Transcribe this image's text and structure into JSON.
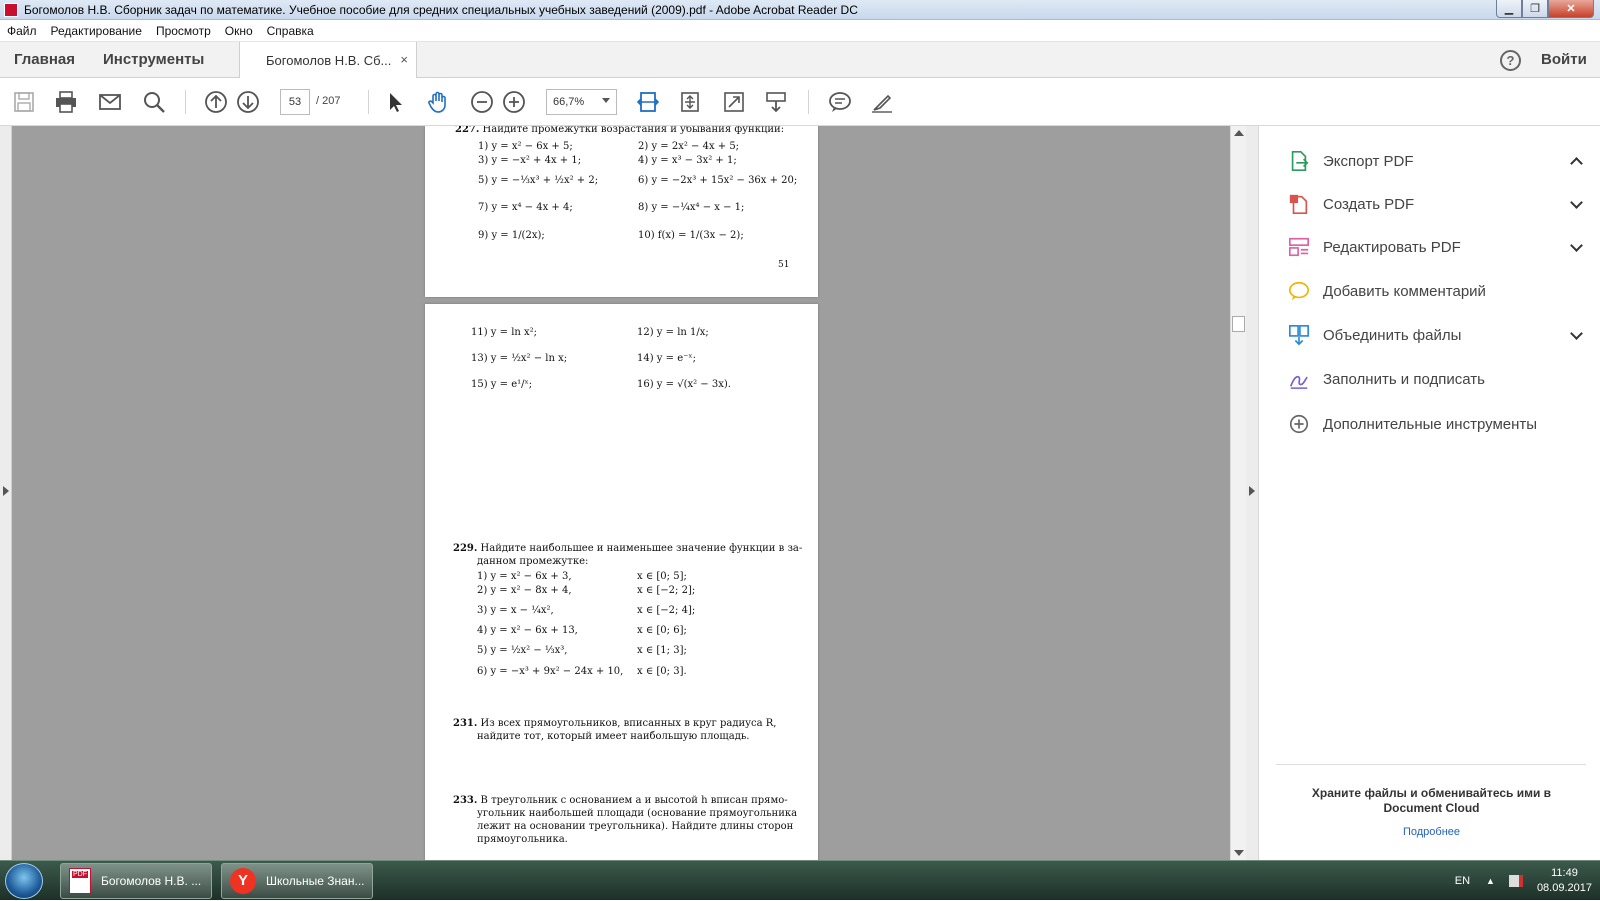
{
  "window": {
    "title": "Богомолов Н.В. Сборник задач по математике. Учебное пособие для средних специальных учебных заведений (2009).pdf - Adobe Acrobat Reader DC"
  },
  "menu": [
    "Файл",
    "Редактирование",
    "Просмотр",
    "Окно",
    "Справка"
  ],
  "tabs": {
    "home": "Главная",
    "tools": "Инструменты",
    "document": "Богомолов Н.В. Сб...",
    "close": "×",
    "help": "?",
    "signin": "Войти"
  },
  "toolbar": {
    "current_page": "53",
    "total_pages": "/ 207",
    "zoom": "66,7%"
  },
  "page1": {
    "lines": [
      {
        "num": "227.",
        "text": "Найдите промежутки возрастания и убывания функции:"
      },
      {
        "num": "",
        "text": "1) y = x² − 6x + 5;"
      },
      {
        "num": "",
        "text": "2) y = 2x² − 4x + 5;"
      },
      {
        "num": "",
        "text": "3) y = −x² + 4x + 1;"
      },
      {
        "num": "",
        "text": "4) y = x³ − 3x² + 1;"
      },
      {
        "num": "",
        "text": "5) y = −⅓x³ + ½x² + 2;"
      },
      {
        "num": "",
        "text": "6) y = −2x³ + 15x² − 36x + 20;"
      },
      {
        "num": "",
        "text": "7) y = x⁴ − 4x + 4;"
      },
      {
        "num": "",
        "text": "8) y = −¼x⁴ − x − 1;"
      },
      {
        "num": "",
        "text": "9) y = 1/(2x);"
      },
      {
        "num": "",
        "text": "10) f(x) = 1/(3x − 2);"
      }
    ],
    "page_number": "51"
  },
  "page2": {
    "lines": [
      {
        "num": "",
        "text": "11) y = ln x²;"
      },
      {
        "num": "",
        "text": "12) y = ln 1/x;"
      },
      {
        "num": "",
        "text": "13) y = ½x² − ln x;"
      },
      {
        "num": "",
        "text": "14) y = e⁻ˣ;"
      },
      {
        "num": "",
        "text": "15) y = e¹/ˣ;"
      },
      {
        "num": "",
        "text": "16) y = √(x² − 3x)."
      },
      {
        "num": "229.",
        "text": "Найдите наибольшее и наименьшее значение функции в за-"
      },
      {
        "num": "",
        "text": "данном промежутке:"
      },
      {
        "num": "",
        "text": "1) y = x² − 6x + 3,"
      },
      {
        "num": "",
        "text": "x ∈ [0; 5];"
      },
      {
        "num": "",
        "text": "2) y = x² − 8x + 4,"
      },
      {
        "num": "",
        "text": "x ∈ [−2; 2];"
      },
      {
        "num": "",
        "text": "3) y = x − ¼x²,"
      },
      {
        "num": "",
        "text": "x ∈ [−2; 4];"
      },
      {
        "num": "",
        "text": "4) y = x² − 6x + 13,"
      },
      {
        "num": "",
        "text": "x ∈ [0; 6];"
      },
      {
        "num": "",
        "text": "5) y = ½x² − ⅓x³,"
      },
      {
        "num": "",
        "text": "x ∈ [1; 3];"
      },
      {
        "num": "",
        "text": "6) y = −x³ + 9x² − 24x + 10,"
      },
      {
        "num": "",
        "text": "x ∈ [0; 3]."
      },
      {
        "num": "231.",
        "text": "Из всех прямоугольников, вписанных в круг радиуса R,"
      },
      {
        "num": "",
        "text": "найдите тот, который имеет наибольшую площадь."
      },
      {
        "num": "233.",
        "text": "В треугольник с основанием a и высотой h вписан прямо-"
      },
      {
        "num": "",
        "text": "угольник наибольшей площади (основание прямоугольника"
      },
      {
        "num": "",
        "text": "лежит на основании треугольника). Найдите длины сторон"
      },
      {
        "num": "",
        "text": "прямоугольника."
      }
    ]
  },
  "right_panel": {
    "items": [
      {
        "label": "Экспорт PDF",
        "icon": "export-pdf-icon",
        "color": "#2d9b5f"
      },
      {
        "label": "Создать PDF",
        "icon": "create-pdf-icon",
        "color": "#d9534f"
      },
      {
        "label": "Редактировать PDF",
        "icon": "edit-pdf-icon",
        "color": "#e05fa5"
      },
      {
        "label": "Добавить комментарий",
        "icon": "comment-icon",
        "color": "#f0b400"
      },
      {
        "label": "Объединить файлы",
        "icon": "combine-files-icon",
        "color": "#2a8bd6"
      },
      {
        "label": "Заполнить и подписать",
        "icon": "fill-sign-icon",
        "color": "#7b5bd6"
      },
      {
        "label": "Дополнительные инструменты",
        "icon": "more-tools-icon",
        "color": "#666666"
      }
    ],
    "promo": "Храните файлы и обменивайтесь ими в Document Cloud",
    "more_link": "Подробнее"
  },
  "taskbar": {
    "items": [
      "Богомолов Н.В. ...",
      "Школьные Знан..."
    ],
    "lang": "EN",
    "time": "11:49",
    "date": "08.09.2017"
  }
}
